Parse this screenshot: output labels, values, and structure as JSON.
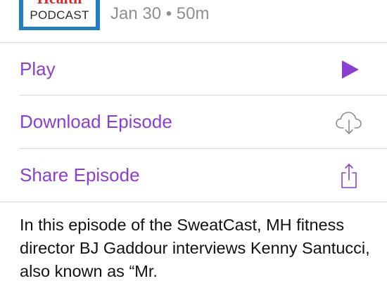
{
  "header": {
    "artwork": {
      "brand": "Health",
      "label": "PODCAST"
    },
    "title_partial": "",
    "meta": "Jan 30 • 50m"
  },
  "actions": [
    {
      "label": "Play",
      "icon": "play-icon"
    },
    {
      "label": "Download Episode",
      "icon": "cloud-download-icon"
    },
    {
      "label": "Share Episode",
      "icon": "share-icon"
    }
  ],
  "description": "In this episode of the SweatCast, MH fitness director BJ Gaddour interviews Kenny Santucci, also known as “Mr.",
  "colors": {
    "accent": "#8a3fd1",
    "meta_text": "#8e8e93",
    "divider": "#d8d8d8",
    "artwork_border": "#1f7fc1",
    "artwork_brand": "#d62a2a"
  }
}
